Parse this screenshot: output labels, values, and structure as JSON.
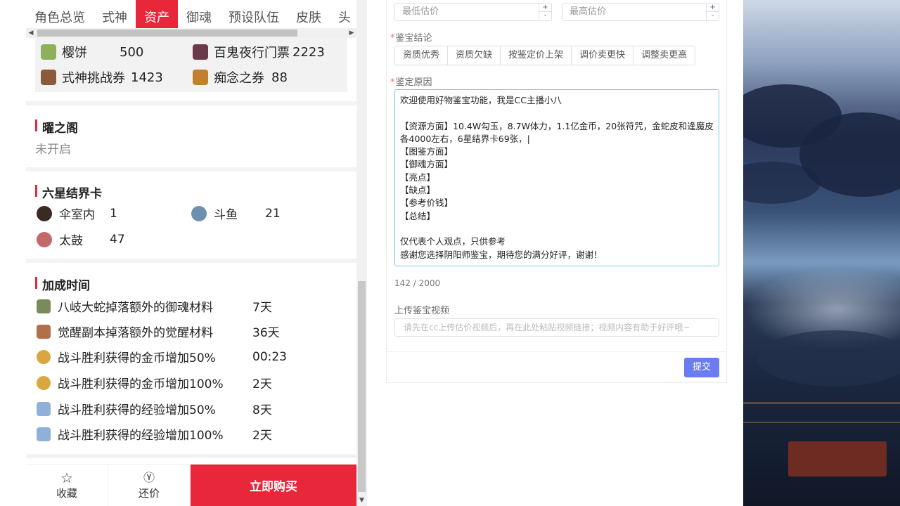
{
  "left": {
    "tabs": [
      "角色总览",
      "式神",
      "资产",
      "御魂",
      "预设队伍",
      "皮肤",
      "头"
    ],
    "active_tab": "资产",
    "resources": [
      {
        "icon": "sakura-cake-icon",
        "name": "樱饼",
        "value": "500"
      },
      {
        "icon": "night-parade-ticket-icon",
        "name": "百鬼夜行门票",
        "value": "2223"
      },
      {
        "icon": "shikigami-challenge-ticket-icon",
        "name": "式神挑战券",
        "value": "1423"
      },
      {
        "icon": "obsession-ticket-icon",
        "name": "痴念之券",
        "value": "88"
      }
    ],
    "yao_pavilion": {
      "title": "曜之阁",
      "status": "未开启"
    },
    "six_star_cards": {
      "title": "六星结界卡",
      "items": [
        {
          "icon": "umbrella-room-icon",
          "name": "伞室内",
          "value": "1"
        },
        {
          "icon": "douyu-icon",
          "name": "斗鱼",
          "value": "21"
        },
        {
          "icon": "taiko-drum-icon",
          "name": "太鼓",
          "value": "47"
        }
      ]
    },
    "buff_time": {
      "title": "加成时间",
      "items": [
        {
          "icon": "orochi-material-icon",
          "text": "八岐大蛇掉落额外的御魂材料",
          "time": "7天"
        },
        {
          "icon": "awaken-material-icon",
          "text": "觉醒副本掉落额外的觉醒材料",
          "time": "36天"
        },
        {
          "icon": "gold-coin-icon",
          "text": "战斗胜利获得的金币增加50%",
          "time": "00:23"
        },
        {
          "icon": "gold-coin-icon",
          "text": "战斗胜利获得的金币增加100%",
          "time": "2天"
        },
        {
          "icon": "exp-potion-icon",
          "text": "战斗胜利获得的经验增加50%",
          "time": "8天"
        },
        {
          "icon": "exp-potion-icon",
          "text": "战斗胜利获得的经验增加100%",
          "time": "2天"
        }
      ]
    },
    "bottom": {
      "favorite": "收藏",
      "counter_offer": "还价",
      "buy_now": "立即购买"
    }
  },
  "form": {
    "min_price_placeholder": "最低估价",
    "max_price_placeholder": "最高估价",
    "conclusion_label": "鉴宝结论",
    "conclusion_options": [
      "资质优秀",
      "资质欠缺",
      "按鉴定价上架",
      "调价卖更快",
      "调整卖更高"
    ],
    "reason_label": "鉴定原因",
    "reason_text": "欢迎使用好物鉴宝功能，我是CC主播小八\n\n【资源方面】10.4W勾玉，8.7W体力，1.1亿金币，20张符咒，金蛇皮和逢魔皮各4000左右，6星结界卡69张，|\n【图鉴方面】\n【御魂方面】\n【亮点】\n【缺点】\n【参考价钱】\n【总结】\n\n仅代表个人观点，只供参考\n感谢您选择阴阳师鉴宝，期待您的满分好评，谢谢！",
    "char_count": "142 / 2000",
    "video_label": "上传鉴宝视频",
    "video_placeholder": "请先在cc上传估价视频后，再在此处粘贴视频链接；视频内容有助于好评哦~",
    "submit_label": "提交"
  },
  "colors": {
    "accent_red": "#e8273a",
    "submit_blue": "#6b7cf0",
    "textarea_border": "#7ec8d8"
  }
}
